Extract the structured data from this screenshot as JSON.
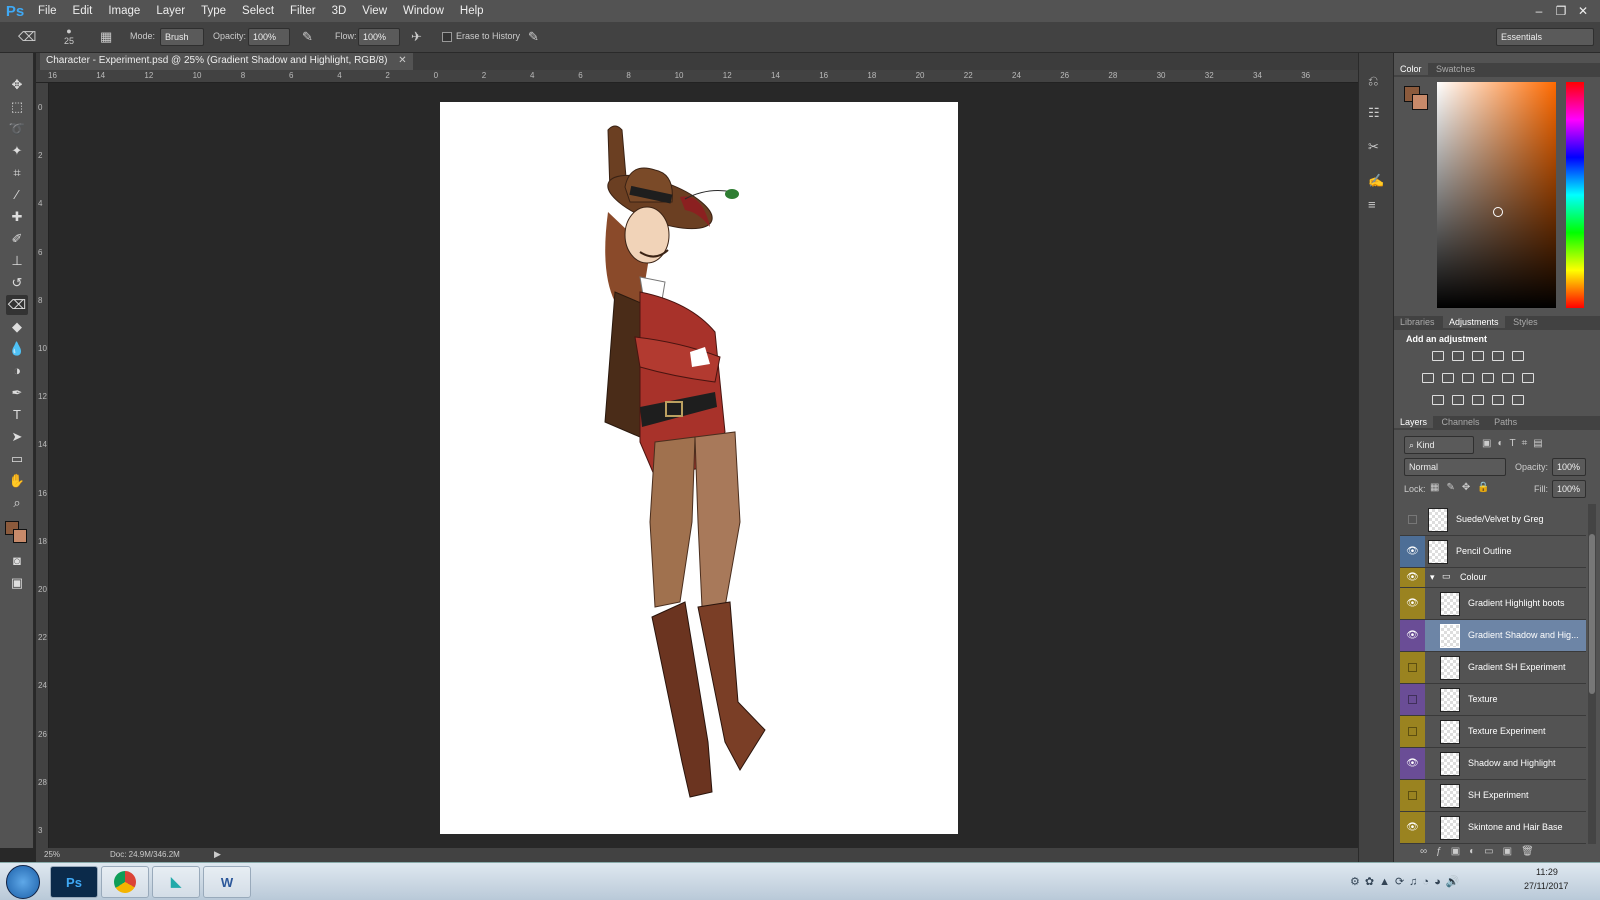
{
  "app": {
    "logo": "Ps",
    "workspace": "Essentials"
  },
  "menu": [
    "File",
    "Edit",
    "Image",
    "Layer",
    "Type",
    "Select",
    "Filter",
    "3D",
    "View",
    "Window",
    "Help"
  ],
  "window_controls": [
    "minimize",
    "restore",
    "close"
  ],
  "options": {
    "brush_size": "25",
    "mode_label": "Mode:",
    "mode_value": "Brush",
    "opacity_label": "Opacity:",
    "opacity_value": "100%",
    "flow_label": "Flow:",
    "flow_value": "100%",
    "erase_history_label": "Erase to History"
  },
  "document": {
    "tab_title": "Character - Experiment.psd @ 25% (Gradient Shadow and Highlight, RGB/8)",
    "zoom": "25%",
    "doc_size": "Doc: 24.9M/346.2M"
  },
  "rulers": {
    "top": [
      "16",
      "14",
      "12",
      "10",
      "8",
      "6",
      "4",
      "2",
      "0",
      "2",
      "4",
      "6",
      "8",
      "10",
      "12",
      "14",
      "16",
      "18",
      "20",
      "22",
      "24",
      "26",
      "28",
      "30",
      "32",
      "34",
      "36"
    ],
    "left": [
      "0",
      "2",
      "4",
      "6",
      "8",
      "10",
      "12",
      "14",
      "16",
      "18",
      "20",
      "22",
      "24",
      "26",
      "28",
      "3"
    ]
  },
  "color_panel": {
    "tabs": [
      "Color",
      "Swatches"
    ],
    "fg": "#8b5a3c",
    "bg": "#c88a6a"
  },
  "adjustments_panel": {
    "tabs": [
      "Libraries",
      "Adjustments",
      "Styles"
    ],
    "heading": "Add an adjustment"
  },
  "layers_panel": {
    "tabs": [
      "Layers",
      "Channels",
      "Paths"
    ],
    "kind": "Kind",
    "blend_mode": "Normal",
    "opacity_label": "Opacity:",
    "opacity_value": "100%",
    "lock_label": "Lock:",
    "fill_label": "Fill:",
    "fill_value": "100%",
    "layers": [
      {
        "name": "Suede/Velvet by Greg",
        "visible": false,
        "tag": "none"
      },
      {
        "name": "Pencil Outline",
        "visible": true,
        "tag": "blue"
      },
      {
        "name": "Colour",
        "visible": true,
        "tag": "yellow",
        "group": true
      },
      {
        "name": "Gradient Highlight boots",
        "visible": true,
        "tag": "yellow"
      },
      {
        "name": "Gradient Shadow and Hig...",
        "visible": true,
        "tag": "violet",
        "selected": true
      },
      {
        "name": "Gradient SH Experiment",
        "visible": false,
        "tag": "yellow"
      },
      {
        "name": "Texture",
        "visible": false,
        "tag": "violet"
      },
      {
        "name": "Texture Experiment",
        "visible": false,
        "tag": "yellow"
      },
      {
        "name": "Shadow and Highlight",
        "visible": true,
        "tag": "violet"
      },
      {
        "name": "SH Experiment",
        "visible": false,
        "tag": "yellow"
      },
      {
        "name": "Skintone and Hair Base",
        "visible": true,
        "tag": "yellow"
      }
    ]
  },
  "taskbar": {
    "time": "11:29",
    "date": "27/11/2017"
  }
}
